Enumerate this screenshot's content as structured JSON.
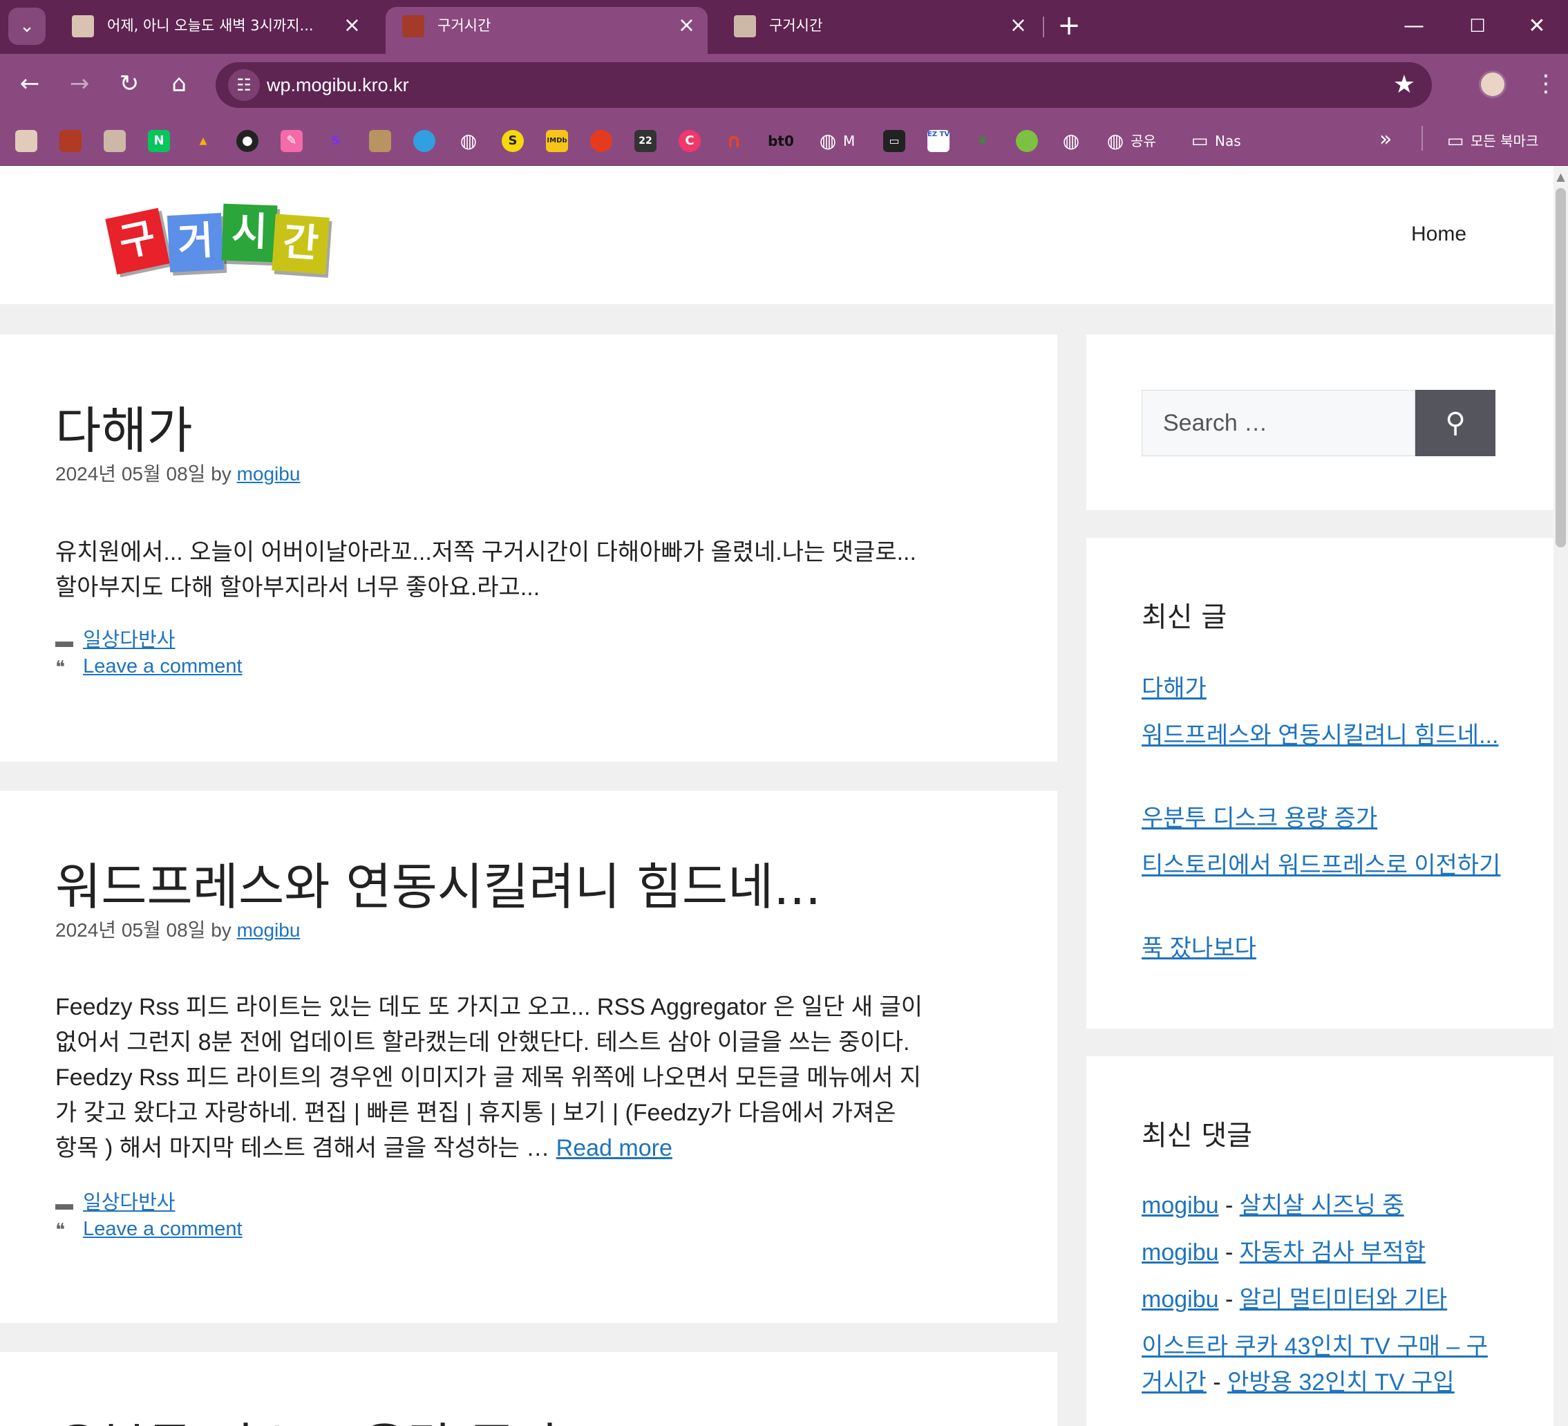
{
  "browser": {
    "tabs": [
      {
        "title": "어제, 아니 오늘도 새벽 3시까지...",
        "active": false
      },
      {
        "title": "구거시간",
        "active": true
      },
      {
        "title": "구거시간",
        "active": false
      }
    ],
    "tab_list_icon": "chevron-down-icon",
    "new_tab": "+",
    "window_controls": {
      "minimize": "—",
      "maximize": "☐",
      "close": "✕"
    },
    "address": "wp.mogibu.kro.kr",
    "bookmarks": [
      {
        "label": "",
        "icon": "avatar"
      },
      {
        "label": "",
        "icon": "pixel-art"
      },
      {
        "label": "",
        "icon": "face"
      },
      {
        "label": "",
        "icon": "naver",
        "glyph": "N"
      },
      {
        "label": "",
        "icon": "pma"
      },
      {
        "label": "",
        "icon": "github"
      },
      {
        "label": "",
        "icon": "pencil"
      },
      {
        "label": "",
        "icon": "s-purple",
        "glyph": "S"
      },
      {
        "label": "",
        "icon": "house"
      },
      {
        "label": "",
        "icon": "chrome-like"
      },
      {
        "label": "",
        "icon": "globe"
      },
      {
        "label": "",
        "icon": "s-yellow",
        "glyph": "S"
      },
      {
        "label": "",
        "icon": "imdb",
        "glyph": "IMDb"
      },
      {
        "label": "",
        "icon": "tomato"
      },
      {
        "label": "",
        "icon": "calendar",
        "glyph": "22"
      },
      {
        "label": "",
        "icon": "c-pink",
        "glyph": "C"
      },
      {
        "label": "",
        "icon": "magnet"
      },
      {
        "label": "",
        "icon": "bt0",
        "glyph": "bt0"
      },
      {
        "label": "M",
        "icon": "globe"
      },
      {
        "label": "",
        "icon": "monitor"
      },
      {
        "label": "",
        "icon": "eztv",
        "glyph": "EZ TV"
      },
      {
        "label": "",
        "icon": "leaf"
      },
      {
        "label": "",
        "icon": "green-ball"
      },
      {
        "label": "",
        "icon": "globe"
      },
      {
        "label": "공유",
        "icon": "globe"
      },
      {
        "label": "Nas",
        "icon": "folder"
      }
    ],
    "more_bookmarks": "»",
    "all_bookmarks": "모든 북마크"
  },
  "site": {
    "nav": {
      "home": "Home"
    },
    "logo_text": [
      "구",
      "거",
      "시",
      "간"
    ],
    "posts": [
      {
        "title": "다해가",
        "date": "2024년 05월 08일",
        "by": "by",
        "author": "mogibu",
        "excerpt": [
          "유치원에서... 오늘이 어버이날아라꼬...저쪽 구거시간이 다해아빠가 올렸네.나는 댓글로...",
          "할아부지도 다해 할아부지라서 너무 좋아요.라고..."
        ],
        "category": "일상다반사",
        "comment_link": "Leave a comment"
      },
      {
        "title": "워드프레스와 연동시킬려니 힘드네...",
        "date": "2024년 05월 08일",
        "by": "by",
        "author": "mogibu",
        "excerpt": [
          "Feedzy Rss 피드 라이트는 있는 데도 또 가지고 오고... RSS Aggregator 은 일단 새 글이",
          "없어서 그런지 8분 전에 업데이트 할라캤는데 안했단다. 테스트 삼아 이글을 쓰는 중이다.",
          "Feedzy Rss 피드 라이트의 경우엔 이미지가 글 제목 위쪽에 나오면서 모든글 메뉴에서 지",
          "가 갖고 왔다고 자랑하네. 편집 | 빠른 편집 | 휴지통 | 보기 | (Feedzy가 다음에서 가져온",
          "항목 ) 해서 마지막 테스트 겸해서 글을 작성하는 …"
        ],
        "read_more": "Read more",
        "category": "일상다반사",
        "comment_link": "Leave a comment"
      },
      {
        "title": "우분투 디스크 용량 증가"
      }
    ],
    "sidebar": {
      "search_placeholder": "Search …",
      "recent_posts_title": "최신 글",
      "recent_posts": [
        "다해가",
        "워드프레스와 연동시킬려니 힘드네...",
        "우분투 디스크 용량 증가",
        "티스토리에서 워드프레스로 이전하기",
        "푹 잤나보다"
      ],
      "recent_comments_title": "최신 댓글",
      "recent_comments": [
        {
          "author": "mogibu",
          "sep": "-",
          "post": "살치살 시즈닝 중"
        },
        {
          "author": "mogibu",
          "sep": "-",
          "post": "자동차 검사 부적합"
        },
        {
          "author": "mogibu",
          "sep": "-",
          "post": "알리 멀티미터와 기타"
        },
        {
          "author": "이스트라 쿠카 43인치 TV 구매 – 구거시간",
          "sep": "-",
          "post": "안방용 32인치 TV 구입"
        }
      ]
    }
  },
  "colors": {
    "tabstrip": "#5f2452",
    "toolbar": "#8a4a80",
    "link": "#1e73be",
    "search_button": "#55555e"
  }
}
